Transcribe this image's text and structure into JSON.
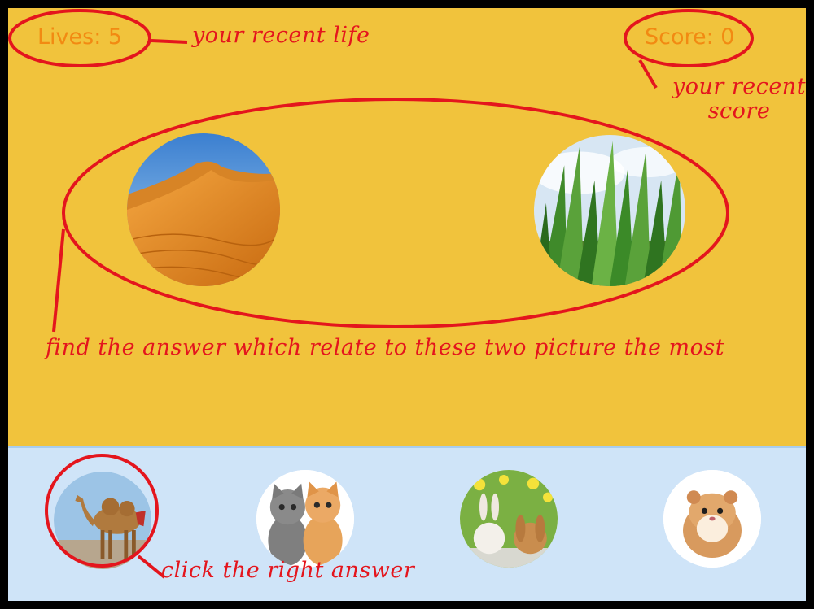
{
  "hud": {
    "lives_label": "Lives: 5",
    "score_label": "Score: 0"
  },
  "annotations": {
    "life_note": "your recent life",
    "score_note_line1": "your recent",
    "score_note_line2": "score",
    "find_note": "find the answer which relate to these two picture the most",
    "click_note": "click the right answer"
  },
  "clues": [
    {
      "icon": "desert-dune-image"
    },
    {
      "icon": "green-grass-image"
    }
  ],
  "choices": [
    {
      "icon": "camel-image",
      "highlighted": true
    },
    {
      "icon": "kittens-image"
    },
    {
      "icon": "rabbits-image"
    },
    {
      "icon": "hamster-image"
    }
  ],
  "colors": {
    "top_panel": "#f1c33c",
    "bottom_panel": "#cfe4f8",
    "hud_text": "#f28a12",
    "annotation_red": "#e4151d"
  }
}
